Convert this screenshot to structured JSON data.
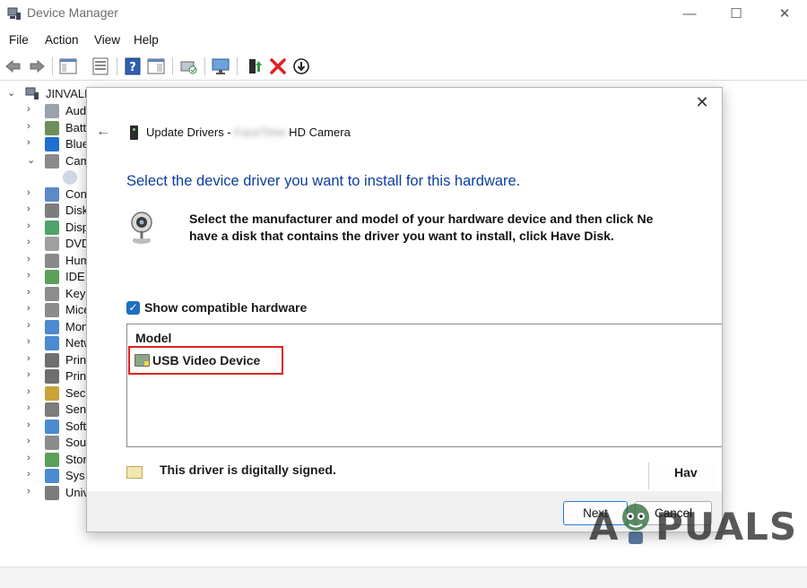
{
  "window": {
    "title": "Device Manager",
    "controls": {
      "minimize": "—",
      "maximize": "☐",
      "close": "✕"
    }
  },
  "menu": [
    "File",
    "Action",
    "View",
    "Help"
  ],
  "toolbar_icons": [
    "back-arrow-icon",
    "forward-arrow-icon",
    "show-hide-console-tree-icon",
    "properties-icon",
    "help-icon",
    "show-action-pane-icon",
    "scan-for-hardware-changes-icon",
    "monitor-icon",
    "enable-device-icon",
    "uninstall-device-icon",
    "update-driver-icon"
  ],
  "tree": {
    "root": "JINVALD",
    "items": [
      {
        "label": "Aud",
        "expanded": false,
        "icon": "audio-icon",
        "color": "#9aa3ad"
      },
      {
        "label": "Batt",
        "expanded": false,
        "icon": "battery-icon",
        "color": "#6e8f59"
      },
      {
        "label": "Blue",
        "expanded": false,
        "icon": "bluetooth-icon",
        "color": "#1f6fd1"
      },
      {
        "label": "Cam",
        "expanded": true,
        "icon": "camera-icon",
        "color": "#8a8a8a"
      },
      {
        "label": "Con",
        "expanded": false,
        "icon": "computer-icon",
        "color": "#5b8ac4"
      },
      {
        "label": "Disk",
        "expanded": false,
        "icon": "disk-drive-icon",
        "color": "#7d7d7d"
      },
      {
        "label": "Disp",
        "expanded": false,
        "icon": "display-adapter-icon",
        "color": "#4fa36a"
      },
      {
        "label": "DVD",
        "expanded": false,
        "icon": "dvd-drive-icon",
        "color": "#a0a0a0"
      },
      {
        "label": "Hum",
        "expanded": false,
        "icon": "human-interface-icon",
        "color": "#8a8a8a"
      },
      {
        "label": "IDE",
        "expanded": false,
        "icon": "ide-controller-icon",
        "color": "#5aa05a"
      },
      {
        "label": "Key",
        "expanded": false,
        "icon": "keyboard-icon",
        "color": "#8c8c8c"
      },
      {
        "label": "Mice",
        "expanded": false,
        "icon": "mouse-icon",
        "color": "#8c8c8c"
      },
      {
        "label": "Mon",
        "expanded": false,
        "icon": "monitor-tree-icon",
        "color": "#4c8bd0"
      },
      {
        "label": "Netw",
        "expanded": false,
        "icon": "network-adapter-icon",
        "color": "#4c8bd0"
      },
      {
        "label": "Prin",
        "expanded": false,
        "icon": "print-queue-icon",
        "color": "#6f6f6f"
      },
      {
        "label": "Prin",
        "expanded": false,
        "icon": "printer-icon",
        "color": "#6f6f6f"
      },
      {
        "label": "Sec",
        "expanded": false,
        "icon": "security-device-icon",
        "color": "#c9a43a"
      },
      {
        "label": "Sen",
        "expanded": false,
        "icon": "sensor-icon",
        "color": "#7c7c7c"
      },
      {
        "label": "Soft",
        "expanded": false,
        "icon": "software-device-icon",
        "color": "#4c8bd0"
      },
      {
        "label": "Sou",
        "expanded": false,
        "icon": "sound-icon",
        "color": "#8c8c8c"
      },
      {
        "label": "Stor",
        "expanded": false,
        "icon": "storage-controller-icon",
        "color": "#5aa05a"
      },
      {
        "label": "Sys",
        "expanded": false,
        "icon": "system-device-icon",
        "color": "#4c8bd0"
      },
      {
        "label": "Univ",
        "expanded": false,
        "icon": "usb-controller-icon",
        "color": "#7c7c7c"
      }
    ]
  },
  "dialog": {
    "close": "✕",
    "back": "←",
    "title_prefix": "Update Drivers - ",
    "title_blurred": "FaceTime",
    "title_suffix": " HD Camera",
    "heading": "Select the device driver you want to install for this hardware.",
    "instruction_line1": "Select the manufacturer and model of your hardware device and then click Ne",
    "instruction_line2": "have a disk that contains the driver you want to install, click Have Disk.",
    "show_compatible_label": "Show compatible hardware",
    "show_compatible_checked": true,
    "model_header": "Model",
    "models": [
      "USB Video Device"
    ],
    "signed_text": "This driver is digitally signed.",
    "have_disk_label": "Hav",
    "next_label": "Next",
    "cancel_label": "Cancel"
  },
  "watermark": {
    "left": "A",
    "right": "PUALS"
  },
  "colors": {
    "heading": "#0c3e9e",
    "highlight_border": "#e0201f",
    "checkbox": "#1c6fbf"
  }
}
